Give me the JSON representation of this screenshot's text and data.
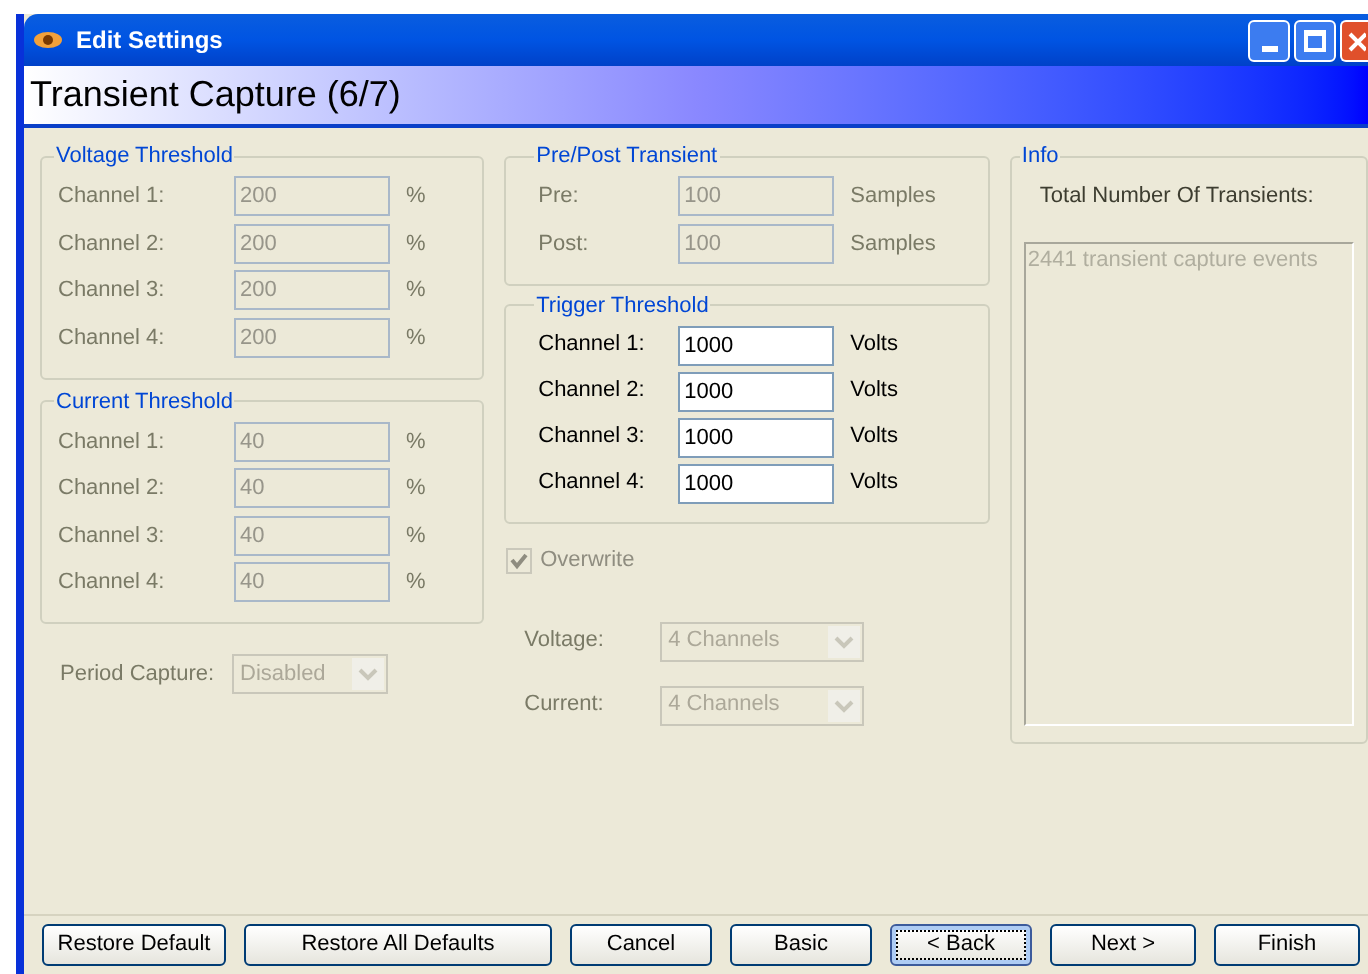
{
  "window": {
    "title": "Edit Settings"
  },
  "heading": "Transient Capture (6/7)",
  "voltage_threshold": {
    "title": "Voltage Threshold",
    "rows": [
      {
        "label": "Channel 1:",
        "value": "200",
        "unit": "%",
        "disabled": true
      },
      {
        "label": "Channel 2:",
        "value": "200",
        "unit": "%",
        "disabled": true
      },
      {
        "label": "Channel 3:",
        "value": "200",
        "unit": "%",
        "disabled": true
      },
      {
        "label": "Channel 4:",
        "value": "200",
        "unit": "%",
        "disabled": true
      }
    ]
  },
  "current_threshold": {
    "title": "Current Threshold",
    "rows": [
      {
        "label": "Channel 1:",
        "value": "40",
        "unit": "%",
        "disabled": true
      },
      {
        "label": "Channel 2:",
        "value": "40",
        "unit": "%",
        "disabled": true
      },
      {
        "label": "Channel 3:",
        "value": "40",
        "unit": "%",
        "disabled": true
      },
      {
        "label": "Channel 4:",
        "value": "40",
        "unit": "%",
        "disabled": true
      }
    ]
  },
  "period_capture": {
    "label": "Period Capture:",
    "value": "Disabled",
    "disabled": true
  },
  "pre_post_transient": {
    "title": "Pre/Post Transient",
    "rows": [
      {
        "label": "Pre:",
        "value": "100",
        "unit": "Samples",
        "disabled": true
      },
      {
        "label": "Post:",
        "value": "100",
        "unit": "Samples",
        "disabled": true
      }
    ]
  },
  "trigger_threshold": {
    "title": "Trigger Threshold",
    "rows": [
      {
        "label": "Channel 1:",
        "value": "1000",
        "unit": "Volts",
        "disabled": false
      },
      {
        "label": "Channel 2:",
        "value": "1000",
        "unit": "Volts",
        "disabled": false
      },
      {
        "label": "Channel 3:",
        "value": "1000",
        "unit": "Volts",
        "disabled": false
      },
      {
        "label": "Channel 4:",
        "value": "1000",
        "unit": "Volts",
        "disabled": false
      }
    ]
  },
  "overwrite": {
    "label": "Overwrite",
    "checked": true,
    "disabled": true
  },
  "voltage": {
    "label": "Voltage:",
    "value": "4 Channels",
    "disabled": true
  },
  "current": {
    "label": "Current:",
    "value": "4 Channels",
    "disabled": true
  },
  "info": {
    "title": "Info",
    "label": "Total Number Of Transients:",
    "text": "2441 transient capture events"
  },
  "buttons": [
    {
      "label": "Restore Default",
      "focused": false
    },
    {
      "label": "Restore All Defaults",
      "focused": false
    },
    {
      "label": "Cancel",
      "focused": false
    },
    {
      "label": "Basic",
      "focused": false
    },
    {
      "label": "< Back",
      "focused": true
    },
    {
      "label": "Next >",
      "focused": false
    },
    {
      "label": "Finish",
      "focused": false
    }
  ]
}
